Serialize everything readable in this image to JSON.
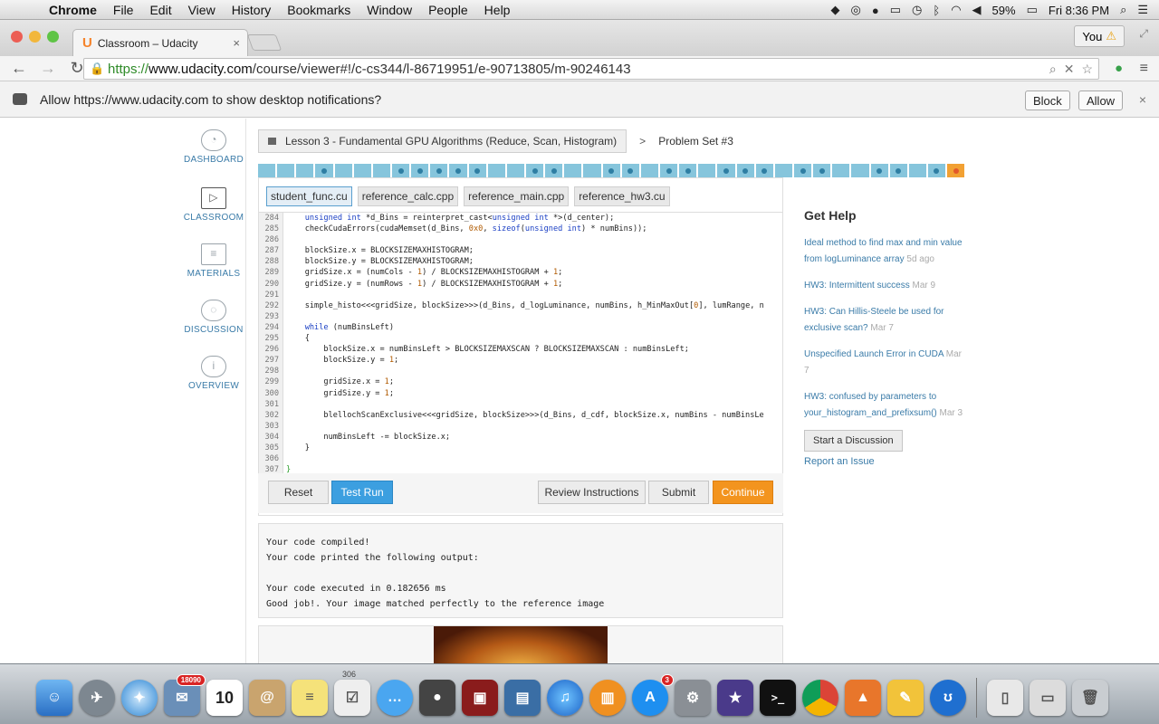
{
  "menubar": {
    "app": "Chrome",
    "items": [
      "File",
      "Edit",
      "View",
      "History",
      "Bookmarks",
      "Window",
      "People",
      "Help"
    ],
    "battery": "59%",
    "clock": "Fri 8:36 PM"
  },
  "browser": {
    "tab_title": "Classroom – Udacity",
    "profile": "You",
    "url_scheme": "https://",
    "url_host": "www.udacity.com",
    "url_path": "/course/viewer#!/c-cs344/l-86719951/e-90713805/m-90246143"
  },
  "notification": {
    "text": "Allow https://www.udacity.com to show desktop notifications?",
    "block": "Block",
    "allow": "Allow"
  },
  "leftnav": [
    {
      "label": "DASHBOARD",
      "icon": "gauge-icon"
    },
    {
      "label": "CLASSROOM",
      "icon": "play-icon"
    },
    {
      "label": "MATERIALS",
      "icon": "document-icon"
    },
    {
      "label": "DISCUSSION",
      "icon": "chat-icon"
    },
    {
      "label": "OVERVIEW",
      "icon": "info-icon"
    }
  ],
  "breadcrumb": {
    "lesson": "Lesson 3 - Fundamental GPU Algorithms (Reduce, Scan, Histogram)",
    "separator": ">",
    "current": "Problem Set #3"
  },
  "progress": {
    "total": 37,
    "dots": [
      4,
      8,
      9,
      10,
      11,
      12,
      15,
      16,
      19,
      20,
      22,
      23,
      25,
      26,
      27,
      29,
      30,
      33,
      34,
      36
    ],
    "current": 37
  },
  "file_tabs": [
    "student_func.cu",
    "reference_calc.cpp",
    "reference_main.cpp",
    "reference_hw3.cu"
  ],
  "code_lines": [
    {
      "n": "284",
      "t": "    unsigned int *d_Bins = reinterpret_cast<unsigned int *>(d_center);"
    },
    {
      "n": "285",
      "t": "    checkCudaErrors(cudaMemset(d_Bins, 0x0, sizeof(unsigned int) * numBins));"
    },
    {
      "n": "286",
      "t": ""
    },
    {
      "n": "287",
      "t": "    blockSize.x = BLOCKSIZEMAXHISTOGRAM;"
    },
    {
      "n": "288",
      "t": "    blockSize.y = BLOCKSIZEMAXHISTOGRAM;"
    },
    {
      "n": "289",
      "t": "    gridSize.x = (numCols - 1) / BLOCKSIZEMAXHISTOGRAM + 1;"
    },
    {
      "n": "290",
      "t": "    gridSize.y = (numRows - 1) / BLOCKSIZEMAXHISTOGRAM + 1;"
    },
    {
      "n": "291",
      "t": ""
    },
    {
      "n": "292",
      "t": "    simple_histo<<<gridSize, blockSize>>>(d_Bins, d_logLuminance, numBins, h_MinMaxOut[0], lumRange, n"
    },
    {
      "n": "293",
      "t": ""
    },
    {
      "n": "294",
      "t": "    while (numBinsLeft)"
    },
    {
      "n": "295",
      "t": "    {"
    },
    {
      "n": "296",
      "t": "        blockSize.x = numBinsLeft > BLOCKSIZEMAXSCAN ? BLOCKSIZEMAXSCAN : numBinsLeft;"
    },
    {
      "n": "297",
      "t": "        blockSize.y = 1;"
    },
    {
      "n": "298",
      "t": ""
    },
    {
      "n": "299",
      "t": "        gridSize.x = 1;"
    },
    {
      "n": "300",
      "t": "        gridSize.y = 1;"
    },
    {
      "n": "301",
      "t": ""
    },
    {
      "n": "302",
      "t": "        blellochScanExclusive<<<gridSize, blockSize>>>(d_Bins, d_cdf, blockSize.x, numBins - numBinsLe"
    },
    {
      "n": "303",
      "t": ""
    },
    {
      "n": "304",
      "t": "        numBinsLeft -= blockSize.x;"
    },
    {
      "n": "305",
      "t": "    }"
    },
    {
      "n": "306",
      "t": ""
    },
    {
      "n": "307",
      "t": "}"
    }
  ],
  "buttons": {
    "reset": "Reset",
    "test_run": "Test Run",
    "review": "Review Instructions",
    "submit": "Submit",
    "continue": "Continue"
  },
  "output": [
    "Your code compiled!",
    "Your code printed the following output:",
    "",
    "Your code executed in 0.182656 ms",
    "Good job!. Your image matched perfectly to the reference image"
  ],
  "help": {
    "title": "Get Help",
    "links": [
      {
        "text": "Ideal method to find max and min value from logLuminance array",
        "date": "5d ago"
      },
      {
        "text": "HW3: Intermittent success",
        "date": "Mar 9"
      },
      {
        "text": "HW3: Can Hillis-Steele be used for exclusive scan?",
        "date": "Mar 7"
      },
      {
        "text": "Unspecified Launch Error in CUDA",
        "date": "Mar 7"
      },
      {
        "text": "HW3: confused by parameters to your_histogram_and_prefixsum()",
        "date": "Mar 3"
      }
    ],
    "start": "Start a Discussion",
    "report": "Report an Issue"
  },
  "dock": {
    "mail_badge": "18090",
    "calendar_day": "10",
    "appstore_badge": "3",
    "label_306": "306"
  },
  "colors": {
    "accent_blue": "#3c9fe0",
    "accent_orange": "#f3941e",
    "link": "#3a7ba8",
    "progress": "#86c5dc"
  }
}
